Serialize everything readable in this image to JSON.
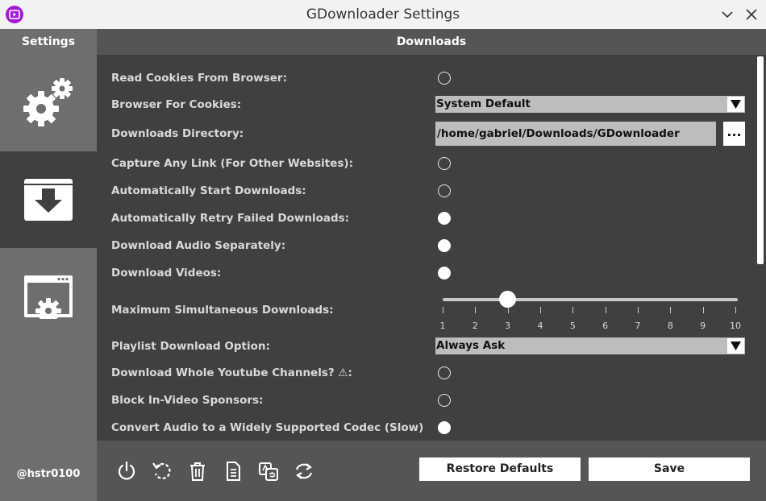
{
  "window": {
    "title": "GDownloader Settings"
  },
  "sidebar": {
    "title": "Settings",
    "items": [
      {
        "name": "general",
        "icon": "gears-icon"
      },
      {
        "name": "downloads",
        "icon": "download-icon"
      },
      {
        "name": "interface",
        "icon": "window-gear-icon"
      }
    ],
    "user": "@hstr0100"
  },
  "header": {
    "title": "Downloads"
  },
  "settings": {
    "read_cookies": {
      "label": "Read Cookies From Browser:",
      "checked": false
    },
    "browser_for_cookies": {
      "label": "Browser For Cookies:",
      "value": "System Default"
    },
    "downloads_directory": {
      "label": "Downloads Directory:",
      "value": "/home/gabriel/Downloads/GDownloader",
      "browse": "..."
    },
    "capture_any_link": {
      "label": "Capture Any Link (For Other Websites):",
      "checked": false
    },
    "auto_start": {
      "label": "Automatically Start Downloads:",
      "checked": false
    },
    "auto_retry": {
      "label": "Automatically Retry Failed Downloads:",
      "checked": true
    },
    "audio_separately": {
      "label": "Download Audio Separately:",
      "checked": true
    },
    "download_videos": {
      "label": "Download Videos:",
      "checked": true
    },
    "max_simultaneous": {
      "label": "Maximum Simultaneous Downloads:",
      "value": 3,
      "min": 1,
      "max": 10,
      "ticks": [
        "1",
        "2",
        "3",
        "4",
        "5",
        "6",
        "7",
        "8",
        "9",
        "10"
      ]
    },
    "playlist_option": {
      "label": "Playlist Download Option:",
      "value": "Always Ask"
    },
    "whole_channels": {
      "label": "Download Whole Youtube Channels? ⚠:",
      "checked": false
    },
    "block_sponsors": {
      "label": "Block In-Video Sponsors:",
      "checked": false
    },
    "convert_audio": {
      "label": "Convert Audio to a Widely Supported Codec (Slow)",
      "checked": true
    }
  },
  "footer": {
    "icons": [
      "power-icon",
      "refresh-icon",
      "trash-icon",
      "document-icon",
      "translate-icon",
      "sync-icon"
    ],
    "restore_label": "Restore Defaults",
    "save_label": "Save"
  },
  "colors": {
    "accent": "#a11bd6",
    "sidebar": "#6e6e6e",
    "header": "#555555",
    "content": "#404040"
  }
}
